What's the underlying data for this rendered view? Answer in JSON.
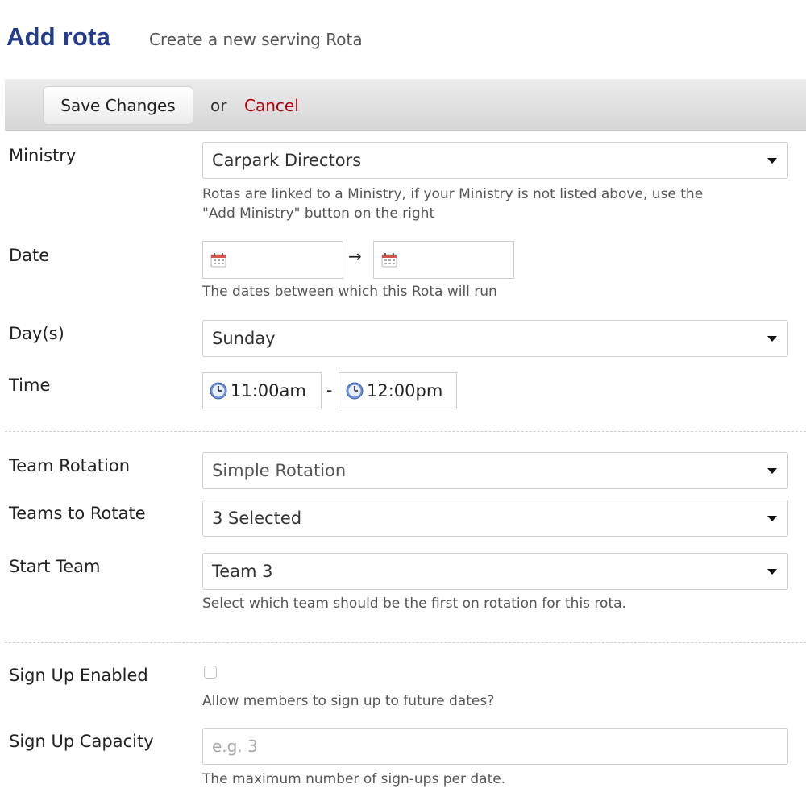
{
  "header": {
    "title": "Add rota",
    "subtitle": "Create a new serving Rota"
  },
  "toolbar": {
    "save_label": "Save Changes",
    "or_text": "or",
    "cancel_label": "Cancel"
  },
  "form": {
    "ministry": {
      "label": "Ministry",
      "value": "Carpark Directors",
      "help_line1": "Rotas are linked to a Ministry, if your Ministry is not listed above, use the",
      "help_line2": "\"Add Ministry\" button on the right"
    },
    "date": {
      "label": "Date",
      "start_value": "",
      "end_value": "",
      "separator": "→",
      "help": "The dates between which this Rota will run"
    },
    "days": {
      "label": "Day(s)",
      "value": "Sunday"
    },
    "time": {
      "label": "Time",
      "start": "11:00am",
      "separator": "-",
      "end": "12:00pm"
    },
    "team_rotation": {
      "label": "Team Rotation",
      "value": "Simple Rotation"
    },
    "teams_to_rotate": {
      "label": "Teams to Rotate",
      "value": "3 Selected"
    },
    "start_team": {
      "label": "Start Team",
      "value": "Team 3",
      "help": "Select which team should be the first on rotation for this rota."
    },
    "signup_enabled": {
      "label": "Sign Up Enabled",
      "checked": false,
      "help": "Allow members to sign up to future dates?"
    },
    "signup_capacity": {
      "label": "Sign Up Capacity",
      "value": "",
      "placeholder": "e.g. 3",
      "help": "The maximum number of sign-ups per date."
    }
  },
  "colors": {
    "title": "#233c8e",
    "cancel": "#b3000e",
    "toolbar_bg": "#dcdcdc"
  }
}
